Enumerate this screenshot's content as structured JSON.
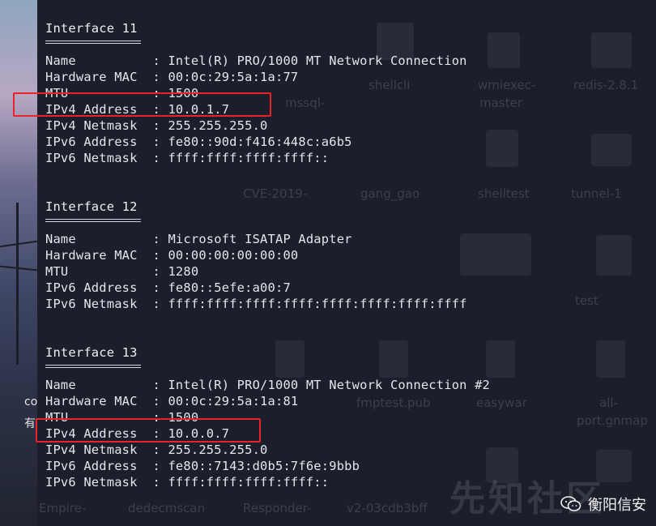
{
  "interfaces": [
    {
      "title": "Interface 11",
      "rows": [
        "Name          : Intel(R) PRO/1000 MT Network Connection",
        "Hardware MAC  : 00:0c:29:5a:1a:77",
        "MTU           : 1500",
        "IPv4 Address  : 10.0.1.7",
        "IPv4 Netmask  : 255.255.255.0",
        "IPv6 Address  : fe80::90d:f416:448c:a6b5",
        "IPv6 Netmask  : ffff:ffff:ffff:ffff::"
      ]
    },
    {
      "title": "Interface 12",
      "rows": [
        "Name          : Microsoft ISATAP Adapter",
        "Hardware MAC  : 00:00:00:00:00:00",
        "MTU           : 1280",
        "IPv6 Address  : fe80::5efe:a00:7",
        "IPv6 Netmask  : ffff:ffff:ffff:ffff:ffff:ffff:ffff:ffff"
      ]
    },
    {
      "title": "Interface 13",
      "rows": [
        "Name          : Intel(R) PRO/1000 MT Network Connection #2",
        "Hardware MAC  : 00:0c:29:5a:1a:81",
        "MTU           : 1500",
        "IPv4 Address  : 10.0.0.7",
        "IPv4 Netmask  : 255.255.255.0",
        "IPv6 Address  : fe80::7143:d0b5:7f6e:9bbb",
        "IPv6 Netmask  : ffff:ffff:ffff:ffff::"
      ]
    }
  ],
  "desktop_ghost_labels": {
    "shellcli": "shellcli",
    "wmiexec": "wmiexec-",
    "master": "master",
    "redis": "redis-2.8.1",
    "mssql": "mssql-",
    "cve": "CVE-2019-",
    "gang_gao": "gang_gao",
    "shelltest": "shelltest",
    "tunnel": "tunnel-1",
    "test": "test",
    "fmptest": "fmptest.pub",
    "easywar": "easywar",
    "port_gnmap": "port.gnmap",
    "empire": "Empire-",
    "dedecmscan": "dedecmscan",
    "responder": "Responder-",
    "v2": "v2-03cdb3bff",
    "all": "all-"
  },
  "left_glyphs": [
    "co",
    "有"
  ],
  "watermark": {
    "text": "衡阳信安",
    "faint_text": "先知社区",
    "icon": "wechat-icon"
  },
  "colors": {
    "terminal_text": "#e4e6ee",
    "highlight_border": "#e8232a",
    "terminal_bg": "#1c1f2a"
  }
}
